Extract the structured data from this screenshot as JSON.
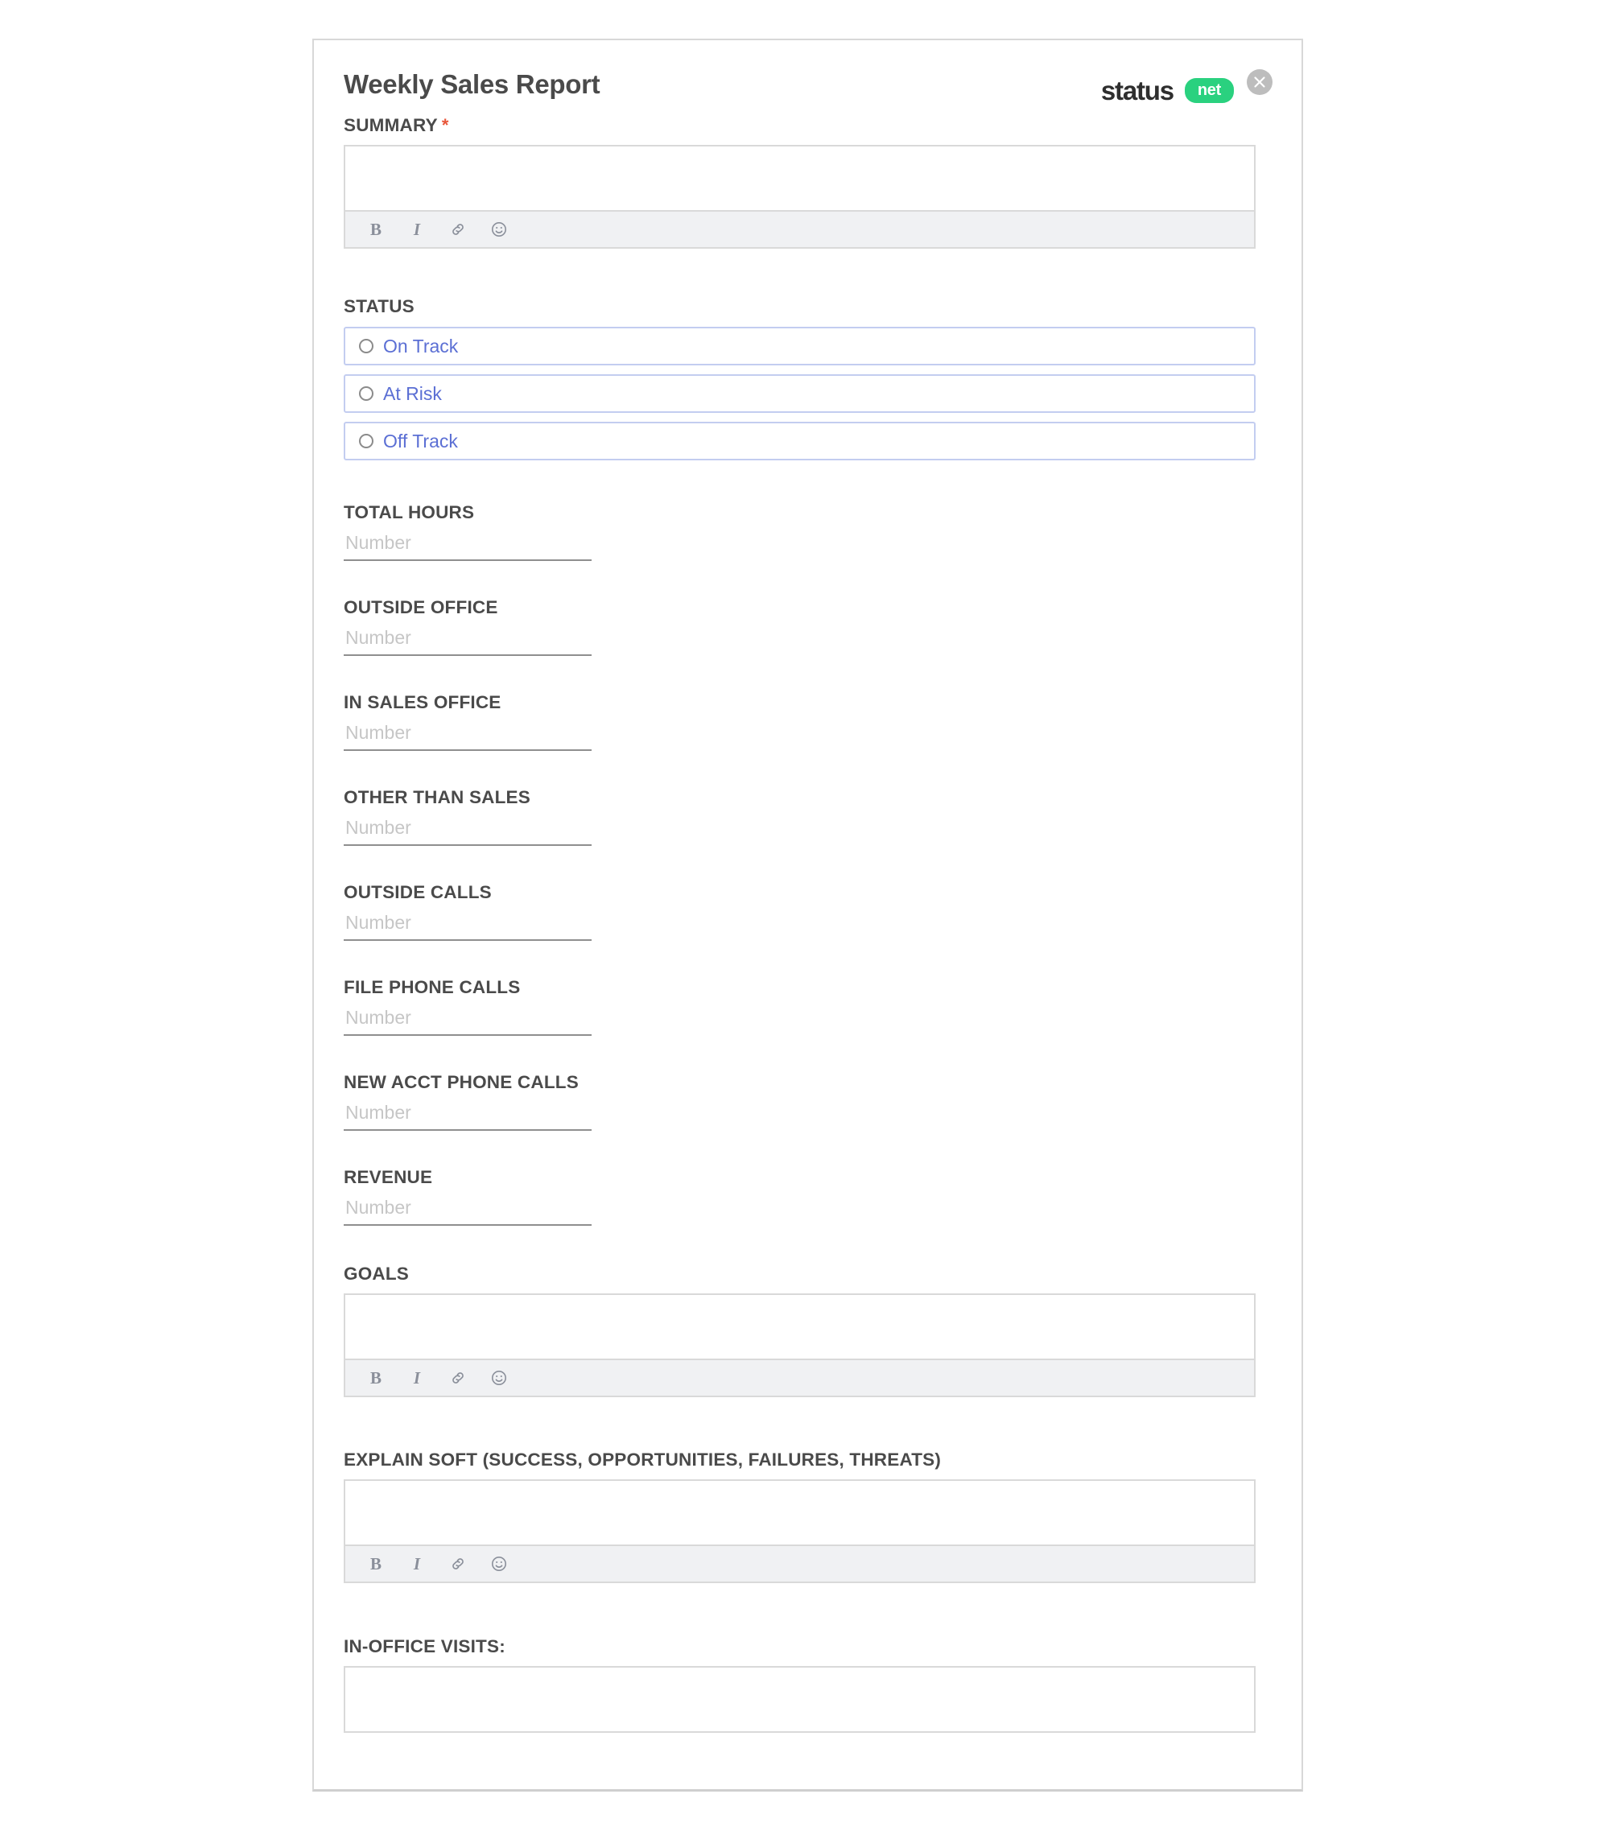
{
  "header": {
    "title": "Weekly Sales Report",
    "brand_word": "status",
    "brand_pill": "net",
    "close_icon": "close-icon"
  },
  "toolbar_icons": {
    "bold": "B",
    "italic": "I",
    "link": "link-icon",
    "emoji": "emoji-icon"
  },
  "fields": {
    "summary": {
      "label": "SUMMARY",
      "required_marker": "*",
      "type": "richtext",
      "value": ""
    },
    "status": {
      "label": "STATUS",
      "type": "radio",
      "options": [
        {
          "label": "On Track",
          "selected": false
        },
        {
          "label": "At Risk",
          "selected": false
        },
        {
          "label": "Off Track",
          "selected": false
        }
      ]
    },
    "numbers": [
      {
        "label": "TOTAL HOURS",
        "placeholder": "Number",
        "value": ""
      },
      {
        "label": "OUTSIDE OFFICE",
        "placeholder": "Number",
        "value": ""
      },
      {
        "label": "IN SALES OFFICE",
        "placeholder": "Number",
        "value": ""
      },
      {
        "label": "OTHER THAN SALES",
        "placeholder": "Number",
        "value": ""
      },
      {
        "label": "OUTSIDE CALLS",
        "placeholder": "Number",
        "value": ""
      },
      {
        "label": "FILE PHONE CALLS",
        "placeholder": "Number",
        "value": ""
      },
      {
        "label": "NEW ACCT PHONE CALLS",
        "placeholder": "Number",
        "value": ""
      },
      {
        "label": "REVENUE",
        "placeholder": "Number",
        "value": ""
      }
    ],
    "goals": {
      "label": "GOALS",
      "type": "richtext",
      "value": ""
    },
    "explain_soft": {
      "label": "EXPLAIN SOFT (SUCCESS, OPPORTUNITIES, FAILURES, THREATS)",
      "type": "richtext",
      "value": ""
    },
    "in_office_visits": {
      "label": "IN-OFFICE VISITS:",
      "type": "richtext",
      "value": ""
    }
  },
  "colors": {
    "accent_green": "#2ad17f",
    "required_red": "#e8563a",
    "radio_blue": "#5b6fd4",
    "radio_border": "#c3cdf0",
    "label_gray": "#4a4a4a"
  }
}
